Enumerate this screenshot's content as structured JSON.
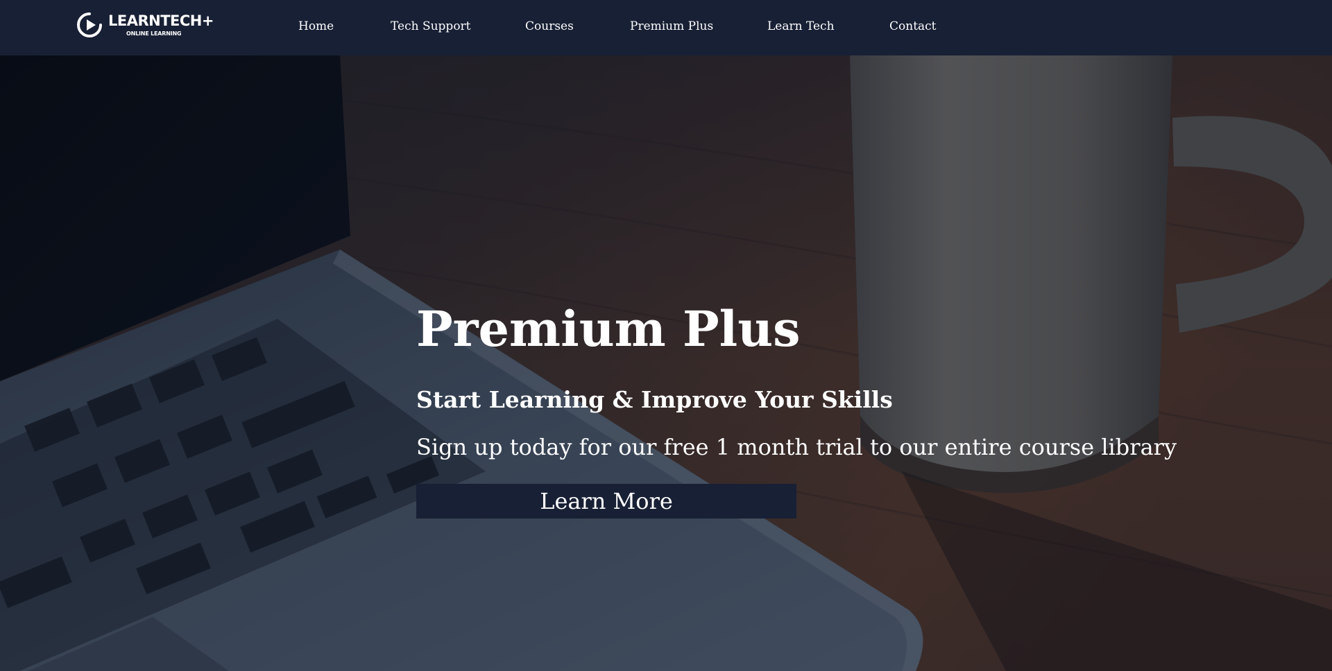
{
  "brand": {
    "name": "LEARNTECH+",
    "tagline": "ONLINE LEARNING",
    "logo_icon": "play-circle-icon"
  },
  "nav": {
    "items": [
      {
        "label": "Home"
      },
      {
        "label": "Tech Support"
      },
      {
        "label": "Courses"
      },
      {
        "label": "Premium Plus"
      },
      {
        "label": "Learn Tech"
      },
      {
        "label": "Contact"
      }
    ]
  },
  "hero": {
    "title": "Premium Plus",
    "subtitle": "Start Learning & Improve Your Skills",
    "text": "Sign up today for our free 1 month trial to our entire course library",
    "button_label": "Learn More"
  },
  "colors": {
    "navbar_bg": "#182035",
    "button_bg": "#182035",
    "text": "#ffffff"
  }
}
